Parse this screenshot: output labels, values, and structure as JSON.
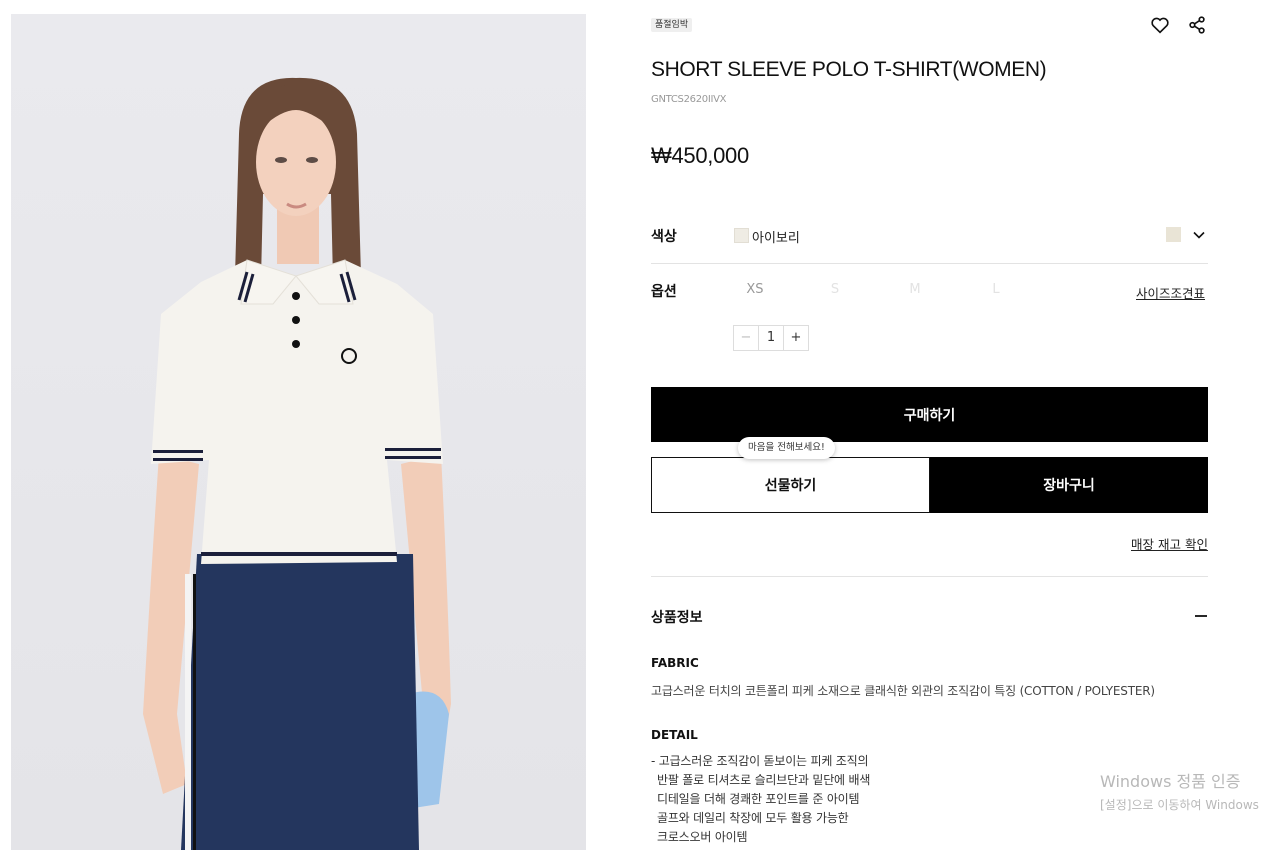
{
  "product": {
    "badge": "품절임박",
    "title": "SHORT SLEEVE POLO T-SHIRT(WOMEN)",
    "sku": "GNTCS2620IIVX",
    "price": "₩450,000",
    "image_alt": "polo shirt model photo"
  },
  "actions": {
    "wishlist_icon": "heart-icon",
    "share_icon": "share-icon"
  },
  "color": {
    "label": "색상",
    "value": "아이보리",
    "swatch_color": "#efece4",
    "dropdown_icon": "chevron-down-icon"
  },
  "options": {
    "label": "옵션",
    "sizes": [
      {
        "label": "XS",
        "available": true
      },
      {
        "label": "S",
        "available": false
      },
      {
        "label": "M",
        "available": false
      },
      {
        "label": "L",
        "available": false
      }
    ],
    "size_chart_link": "사이즈조견표"
  },
  "quantity": {
    "minus": "−",
    "value": "1",
    "plus": "+"
  },
  "buttons": {
    "buy": "구매하기",
    "gift": "선물하기",
    "gift_tooltip": "마음을 전해보세요!",
    "cart": "장바구니",
    "store_stock": "매장 재고 확인"
  },
  "info": {
    "section_title": "상품정보",
    "collapse_icon": "minus-icon",
    "fabric_title": "FABRIC",
    "fabric_text": "고급스러운 터치의 코튼폴리 피케 소재으로 클래식한 외관의 조직감이 특징 (COTTON / POLYESTER)",
    "detail_title": "DETAIL",
    "detail_lines": [
      "- 고급스러운 조직감이 돋보이는 피케 조직의",
      "반팔 폴로 티셔츠로 슬리브단과 밑단에 배색",
      "디테일을 더해 경쾌한 포인트를 준 아이템",
      "골프와 데일리 착장에 모두 활용 가능한",
      "크로스오버 아이템"
    ]
  },
  "watermark": {
    "line1": "Windows 정품 인증",
    "line2": "[설정]으로 이동하여 Windows"
  },
  "colors": {
    "button_black": "#000000",
    "divider": "#e3e3e3",
    "muted_text": "#999999"
  }
}
